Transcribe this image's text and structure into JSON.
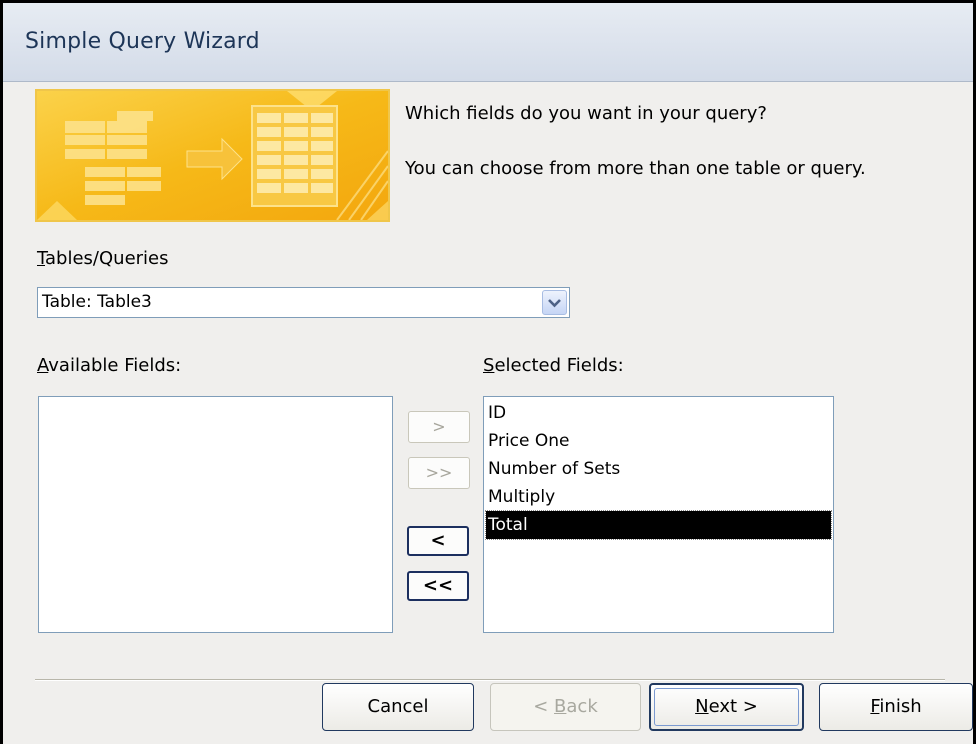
{
  "window": {
    "title": "Simple Query Wizard"
  },
  "prompt": {
    "line1": "Which fields do you want in your query?",
    "line2": "You can choose from more than one table or query."
  },
  "tables_queries": {
    "label_access_key": "T",
    "label_rest": "ables/Queries",
    "selected_value": "Table: Table3"
  },
  "available_fields": {
    "label_access_key": "A",
    "label_rest": "vailable Fields:",
    "items": []
  },
  "selected_fields": {
    "label_access_key": "S",
    "label_rest": "elected Fields:",
    "items": [
      "ID",
      "Price One",
      "Number of Sets",
      "Multiply",
      "Total"
    ],
    "selected_item": "Total"
  },
  "move_buttons": {
    "add_one": ">",
    "add_all": ">>",
    "remove_one": "<",
    "remove_all": "<<"
  },
  "footer": {
    "cancel": "Cancel",
    "back_prefix": "< ",
    "back_key": "B",
    "back_rest": "ack",
    "next_key": "N",
    "next_rest": "ext >",
    "finish_key": "F",
    "finish_rest": "inish"
  },
  "colors": {
    "banner_gold": "#f6b918",
    "selection": "#000000",
    "title_text": "#1d3557"
  },
  "icons": {
    "dropdown": "chevron-down-icon",
    "banner": "table-transfer-graphic"
  }
}
